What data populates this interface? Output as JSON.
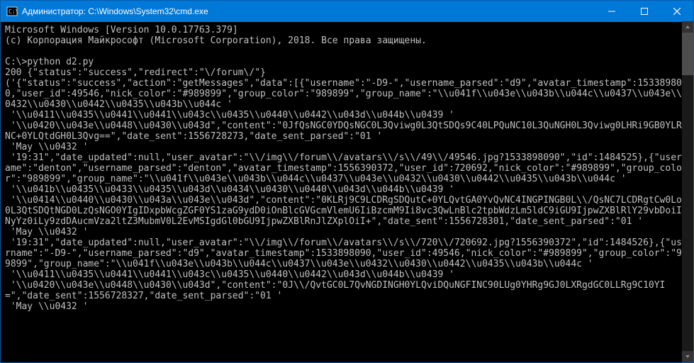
{
  "window": {
    "title": "Администратор: C:\\Windows\\System32\\cmd.exe"
  },
  "terminal": {
    "lines": [
      "Microsoft Windows [Version 10.0.17763.379]",
      "(c) Корпорация Майкрософт (Microsoft Corporation), 2018. Все права защищены.",
      "",
      "C:\\>python d2.py",
      "200 {\"status\":\"success\",\"redirect\":\"\\/forum\\/\"}",
      "('{\"status\":\"success\",\"action\":\"getMessages\",\"data\":[{\"username\":\"-D9-\",\"username_parsed\":\"d9\",\"avatar_timestamp\":1533898090,\"user_id\":49546,\"nick_color\":\"#989899\",\"group_color\":\"989899\",\"group_name\":\"\\\\u041f\\\\u043e\\\\u043b\\\\u044c\\\\u0437\\\\u043e\\\\u0432\\\\u0430\\\\u0442\\\\u0435\\\\u043b\\\\u044c '",
      " '\\\\u0411\\\\u0435\\\\u0441\\\\u0441\\\\u043c\\\\u0435\\\\u0440\\\\u0442\\\\u043d\\\\u044b\\\\u0439 '",
      " '\\\\u0420\\\\u043e\\\\u0448\\\\u0430\\\\u043d\",\"content\":\"0JfQsNGC0YDQsNGC0L3Qviwg0L3QtSDQs9C40LPQuNC10L3QuNGH0L3Qviwg0LHRi9GB0YLRgNC+0YLQtdGH0L3Qvg==\",\"date_sent\":1556728273,\"date_sent_parsed\":\"01 '",
      " 'May \\\\u0432 '",
      " '19:31\",\"date_updated\":null,\"user_avatar\":\"\\\\/img\\\\/forum\\\\/avatars\\\\/s\\\\/49\\\\/49546.jpg?1533898090\",\"id\":1484525},{\"username\":\"denton\",\"username_parsed\":\"denton\",\"avatar_timestamp\":1556390372,\"user_id\":720692,\"nick_color\":\"#989899\",\"group_color\":\"989899\",\"group_name\":\"\\\\u041f\\\\u043e\\\\u043b\\\\u044c\\\\u0437\\\\u043e\\\\u0432\\\\u0430\\\\u0442\\\\u0435\\\\u043b\\\\u044c '",
      " '\\\\u041b\\\\u0435\\\\u0433\\\\u0435\\\\u043d\\\\u0434\\\\u0430\\\\u0440\\\\u043d\\\\u044b\\\\u0439 '",
      " '\\\\u0414\\\\u0440\\\\u0430\\\\u043a\\\\u043e\\\\u043d\",\"content\":\"0KLRj9C9LCDRgSDQutC+0YLQvtGA0YvQvNC4INGPINGB0L\\\\/QsNC7LCDRgtCw0Log0L3QtSDQtNGD0LzQsNGO0YIgIDxpbWcgZGF0YS1zaG9ydD0iOnBlcGVGcmVlemU6IiBzcmM9Ii8vc3QwLnBlc2tpbWdzLm5ldC9iGU9IjpwZXBlRlY29vbDoiIHNyYz0iLy9zdDAucmVza2ltZ3MubmV0L2EvMSIgdGl0bGU9IjpwZXBlRnJlZXplOiI+\",\"date_sent\":1556728301,\"date_sent_parsed\":\"01 '",
      " 'May \\\\u0432 '",
      " '19:31\",\"date_updated\":null,\"user_avatar\":\"\\\\/img\\\\/forum\\\\/avatars\\\\/s\\\\/720\\\\/720692.jpg?1556390372\",\"id\":1484526},{\"username\":\"-D9-\",\"username_parsed\":\"d9\",\"avatar_timestamp\":1533898090,\"user_id\":49546,\"nick_color\":\"#989899\",\"group_color\":\"989899\",\"group_name\":\"\\\\u041f\\\\u043e\\\\u043b\\\\u044c\\\\u0437\\\\u043e\\\\u0432\\\\u0430\\\\u0442\\\\u0435\\\\u043b\\\\u044c '",
      " '\\\\u0411\\\\u0435\\\\u0441\\\\u0441\\\\u043c\\\\u0435\\\\u0440\\\\u0442\\\\u043d\\\\u044b\\\\u0439 '",
      " '\\\\u0420\\\\u043e\\\\u0448\\\\u0430\\\\u043d\",\"content\":\"0J\\\\/QvtGC0L7QvNGDINGH0YLQviDQuNGFINC90LUg0YHRg9GJ0LXRgdGC0LLRg9C10YI=\",\"date_sent\":1556728327,\"date_sent_parsed\":\"01 '",
      " 'May \\\\u0432 '"
    ]
  }
}
